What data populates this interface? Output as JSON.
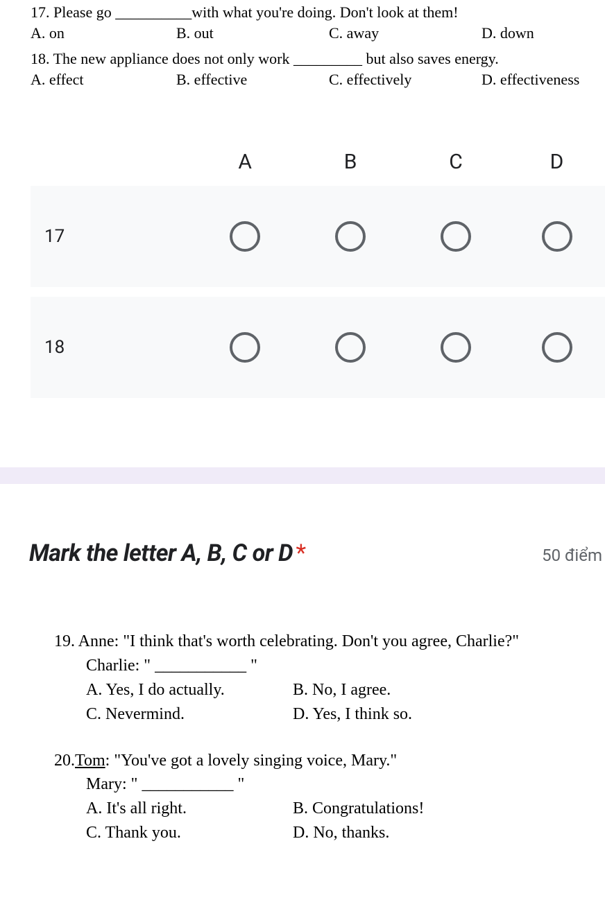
{
  "questions_top": {
    "q17": {
      "text": "17. Please go __________with what you're doing. Don't look at them!",
      "opts": {
        "a": "A. on",
        "b": "B. out",
        "c": "C. away",
        "d": "D. down"
      }
    },
    "q18": {
      "text": "18. The new appliance does not only work _________ but also saves energy.",
      "opts": {
        "a": "A. effect",
        "b": "B. effective",
        "c": "C. effectively",
        "d": "D. effectiveness"
      }
    }
  },
  "grid": {
    "headers": {
      "a": "A",
      "b": "B",
      "c": "C",
      "d": "D"
    },
    "rows": [
      {
        "label": "17"
      },
      {
        "label": "18"
      }
    ]
  },
  "section2": {
    "title": "Mark the letter A, B, C or D",
    "required_mark": "*",
    "points": "50 điểm"
  },
  "questions_bottom": {
    "q19": {
      "lead": "19. Anne: \"I think that's worth celebrating. Don't you agree, Charlie?\"",
      "line2": "Charlie: \" ___________ \"",
      "optA": "A. Yes, I do actually.",
      "optB": "B. No, I agree.",
      "optC": "C. Nevermind.",
      "optD": "D. Yes, I think so."
    },
    "q20": {
      "lead_prefix": "20.",
      "lead_name": "Tom",
      "lead_rest": ": \"You've got a lovely singing voice, Mary.\"",
      "line2": "Mary: \" ___________ \"",
      "optA": "A. It's all right.",
      "optB": "B. Congratulations!",
      "optC": "C. Thank you.",
      "optD": "D. No, thanks."
    }
  }
}
